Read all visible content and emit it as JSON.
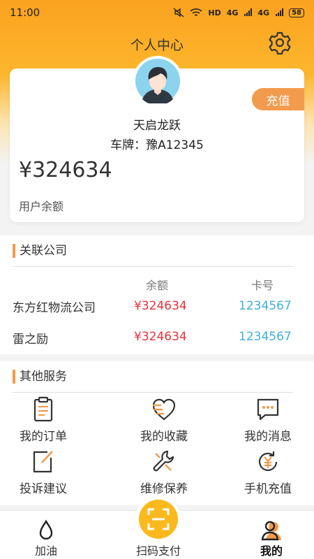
{
  "status_bar": {
    "time": "11:00",
    "network": "HD",
    "signal1": "4G",
    "signal2": "4G",
    "battery": "58"
  },
  "header": {
    "title": "个人中心"
  },
  "profile": {
    "name": "天启龙跃",
    "plate": "车牌：豫A12345",
    "balance": "¥324634",
    "balance_label": "用户余额",
    "recharge_label": "充值"
  },
  "company": {
    "title": "关联公司",
    "columns": {
      "balance": "余额",
      "card": "卡号"
    },
    "rows": [
      {
        "name": "东方红物流公司",
        "balance": "¥324634",
        "card": "1234567"
      },
      {
        "name": "雷之励",
        "balance": "¥324634",
        "card": "1234567"
      }
    ]
  },
  "services": {
    "title": "其他服务",
    "items": [
      {
        "label": "我的订单",
        "icon": "order-list-icon"
      },
      {
        "label": "我的收藏",
        "icon": "heart-list-icon"
      },
      {
        "label": "我的消息",
        "icon": "message-icon"
      },
      {
        "label": "投诉建议",
        "icon": "edit-note-icon"
      },
      {
        "label": "维修保养",
        "icon": "repair-tools-icon"
      },
      {
        "label": "手机充值",
        "icon": "yuan-recharge-icon"
      }
    ]
  },
  "tabs": [
    {
      "label": "加油",
      "icon": "fuel-drop-icon"
    },
    {
      "label": "扫码支付",
      "icon": "scan-icon"
    },
    {
      "label": "我的",
      "icon": "user-icon",
      "active": true
    }
  ],
  "colors": {
    "accent": "#fba21f",
    "orange_tag": "#f39b4d",
    "amount_red": "#e8313a",
    "card_blue": "#3fb0d8",
    "scan_yellow": "#fbb91d"
  }
}
